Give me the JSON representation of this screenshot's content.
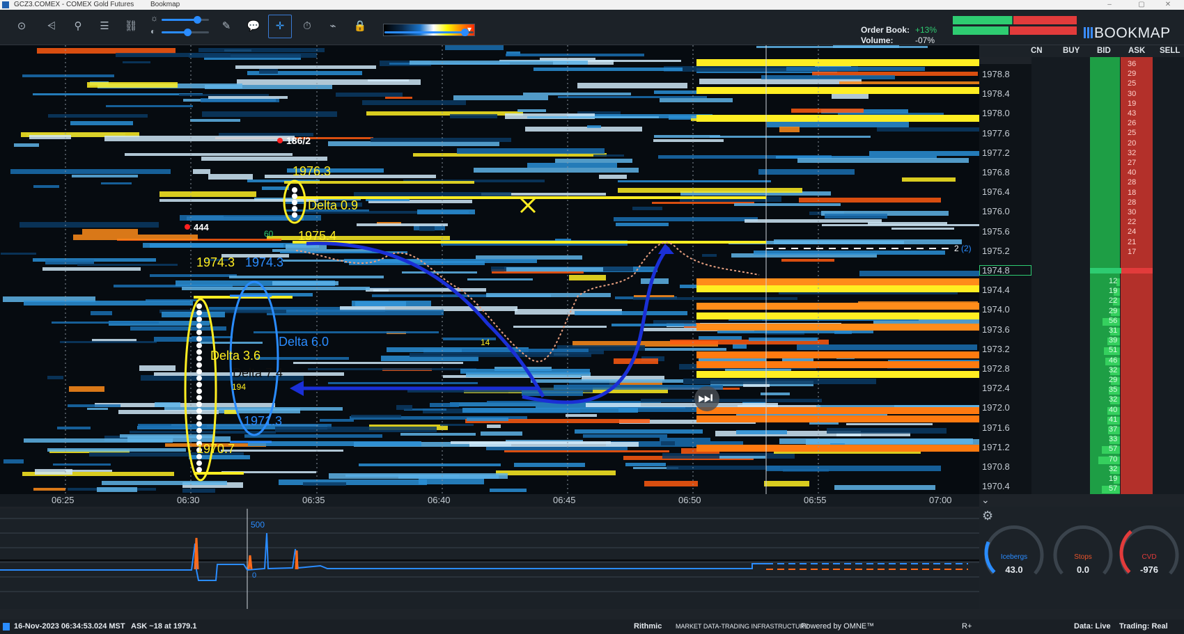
{
  "window": {
    "title": "GCZ3.COMEX - COMEX Gold Futures",
    "app": "Bookmap",
    "minimize_icon": "–",
    "maximize_icon": "▢",
    "close_icon": "✕"
  },
  "toolbar": {
    "buttons": [
      {
        "icon": "camera-icon",
        "glyph": "⊙"
      },
      {
        "icon": "share-icon",
        "glyph": "⩤"
      },
      {
        "icon": "pin-icon",
        "glyph": "⚲"
      },
      {
        "icon": "layers-icon",
        "glyph": "☰"
      },
      {
        "icon": "link-icon",
        "glyph": "⛓"
      },
      {
        "icon": "pencil-icon",
        "glyph": "✎"
      },
      {
        "icon": "chat-icon",
        "glyph": "💬"
      },
      {
        "icon": "crosshair-icon",
        "glyph": "✛"
      },
      {
        "icon": "timer-icon",
        "glyph": "⏱"
      },
      {
        "icon": "indicator-icon",
        "glyph": "⌁"
      },
      {
        "icon": "lock-icon",
        "glyph": "🔒"
      }
    ],
    "brightness_icon": "☼",
    "contrast_icon": "◐",
    "brightness_level": 0.75,
    "contrast_level": 0.55,
    "colormap_level": 0.9,
    "colormap_dropdown_icon": "▾",
    "accent": "#2a8cff"
  },
  "order_book": {
    "label_orderbook": "Order Book:",
    "label_volume": "Volume:",
    "orderbook_change": "+13%",
    "volume_change": "-07%",
    "up_color": "#2ecc71",
    "down_color": "#e23b3b"
  },
  "logo": {
    "text": "BOOKMAP"
  },
  "columns": {
    "headers": [
      "CN",
      "BUY",
      "BID",
      "ASK",
      "SELL"
    ]
  },
  "price_axis": {
    "labels": [
      "1978.8",
      "1978.4",
      "1978.0",
      "1977.6",
      "1977.2",
      "1976.8",
      "1976.4",
      "1976.0",
      "1975.6",
      "1975.2",
      "1974.8",
      "1974.4",
      "1974.0",
      "1973.6",
      "1973.2",
      "1972.8",
      "1972.4",
      "1972.0",
      "1971.6",
      "1971.2",
      "1970.8",
      "1970.4"
    ],
    "current_price": "1974.8",
    "current_marker": "2",
    "current_marker_paren": "(2)"
  },
  "dom": {
    "ask_sizes": [
      "36",
      "29",
      "25",
      "30",
      "19",
      "43",
      "26",
      "25",
      "20",
      "32",
      "27",
      "40",
      "28",
      "18",
      "28",
      "30",
      "22",
      "24",
      "21",
      "17"
    ],
    "bid_sizes": [
      "12",
      "19",
      "22",
      "29",
      "56",
      "31",
      "39",
      "51",
      "46",
      "32",
      "29",
      "35",
      "32",
      "40",
      "41",
      "37",
      "33",
      "57",
      "70",
      "32",
      "19",
      "57"
    ],
    "bid_color": "#1e9e45",
    "ask_color": "#b3302a"
  },
  "annotations": {
    "price_1976_3": "1976.3",
    "delta_09": "Delta 0.9",
    "price_1975_4": "1975.4",
    "price_1974_3_a": "1974.3",
    "price_1974_3_b": "1974.3",
    "delta_36": "Delta 3.6",
    "delta_60": "Delta 6.0",
    "delta_74": "Delta 7.4",
    "price_1971_3": "1971.3",
    "price_1970_7": "1970.7",
    "trade_186": "186/2",
    "trade_444": "444",
    "num_60": "60",
    "num_14": "14",
    "num_194": "194"
  },
  "time_axis": {
    "labels": [
      "06:25",
      "06:30",
      "06:35",
      "06:40",
      "06:45",
      "06:50",
      "06:55",
      "07:00"
    ]
  },
  "indicator": {
    "max_label": "500",
    "zero_label": "0"
  },
  "gauges": [
    {
      "name": "Icebergs",
      "value": "43.0",
      "color": "#2a8cff",
      "level": 0.25
    },
    {
      "name": "Stops",
      "value": "0.0",
      "color": "#e8532b",
      "level": 0.0
    },
    {
      "name": "CVD",
      "value": "-976",
      "color": "#e23b3b",
      "level": 0.35
    }
  ],
  "settings_icon": "⚙",
  "collapse_icon": "⌄",
  "play_icon": "⏭",
  "statusbar": {
    "timestamp": "16-Nov-2023 06:34:53.024 MST",
    "ask_info": "ASK ~18 at 1979.1",
    "provider": "Rithmic",
    "provider_tag": "MARKET DATA-TRADING INFRASTRUCTURE",
    "powered": "Powered by OMNE™",
    "r_plus": "R+",
    "data_status": "Data: Live",
    "trading_status": "Trading: Real"
  }
}
